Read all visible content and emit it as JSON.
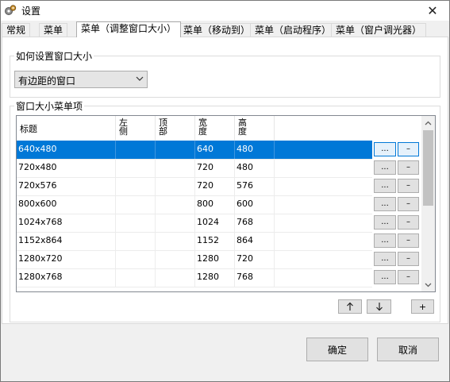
{
  "window": {
    "title": "设置",
    "close_glyph": "✕"
  },
  "tabs": [
    {
      "label": "常规",
      "active": false
    },
    {
      "label": "菜单",
      "active": false
    },
    {
      "label": "菜单（调整窗口大小）",
      "active": true
    },
    {
      "label": "菜单（移动到）",
      "active": false
    },
    {
      "label": "菜单（启动程序）",
      "active": false
    },
    {
      "label": "菜单（窗户调光器）",
      "active": false
    }
  ],
  "size_group": {
    "legend": "如何设置窗口大小",
    "dropdown": {
      "selected": "有边距的窗口"
    }
  },
  "items_group": {
    "legend": "窗口大小菜单项",
    "columns": {
      "title": "标题",
      "left": "左侧",
      "top": "顶部",
      "width": "宽度",
      "height": "高度"
    },
    "rows": [
      {
        "title": "640x480",
        "left": "",
        "top": "",
        "width": "640",
        "height": "480",
        "selected": true
      },
      {
        "title": "720x480",
        "left": "",
        "top": "",
        "width": "720",
        "height": "480",
        "selected": false
      },
      {
        "title": "720x576",
        "left": "",
        "top": "",
        "width": "720",
        "height": "576",
        "selected": false
      },
      {
        "title": "800x600",
        "left": "",
        "top": "",
        "width": "800",
        "height": "600",
        "selected": false
      },
      {
        "title": "1024x768",
        "left": "",
        "top": "",
        "width": "1024",
        "height": "768",
        "selected": false
      },
      {
        "title": "1152x864",
        "left": "",
        "top": "",
        "width": "1152",
        "height": "864",
        "selected": false
      },
      {
        "title": "1280x720",
        "left": "",
        "top": "",
        "width": "1280",
        "height": "720",
        "selected": false
      },
      {
        "title": "1280x768",
        "left": "",
        "top": "",
        "width": "1280",
        "height": "768",
        "selected": false
      }
    ],
    "row_edit_label": "...",
    "row_remove_label": "–",
    "add_label": "+"
  },
  "buttons": {
    "ok": "确定",
    "cancel": "取消"
  }
}
